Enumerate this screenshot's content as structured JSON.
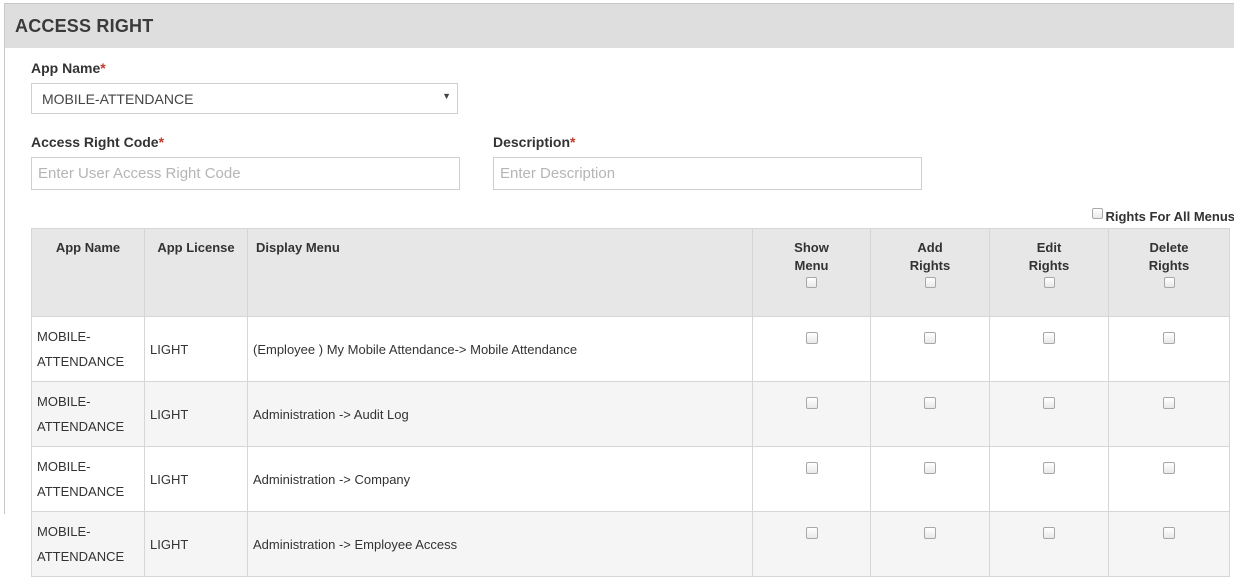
{
  "header": {
    "title": "ACCESS RIGHT"
  },
  "form": {
    "app_name": {
      "label": "App Name",
      "required_mark": "*",
      "value": "MOBILE-ATTENDANCE",
      "arrow": "▼"
    },
    "access_right_code": {
      "label": "Access Right Code",
      "required_mark": "*",
      "placeholder": "Enter User Access Right Code"
    },
    "description": {
      "label": "Description",
      "required_mark": "*",
      "placeholder": "Enter Description"
    }
  },
  "rights_for_all_menus": {
    "label": "Rights For All Menus",
    "checked": false
  },
  "table": {
    "columns": {
      "app_name": "App Name",
      "app_license": "App License",
      "display_menu": "Display Menu",
      "show_menu": [
        "Show",
        "Menu"
      ],
      "add_rights": [
        "Add",
        "Rights"
      ],
      "edit_rights": [
        "Edit",
        "Rights"
      ],
      "delete_rights": [
        "Delete",
        "Rights"
      ]
    },
    "rows": [
      {
        "app_name": "MOBILE-ATTENDANCE",
        "app_license": "LIGHT",
        "display_menu": "(Employee ) My Mobile Attendance-> Mobile Attendance"
      },
      {
        "app_name": "MOBILE-ATTENDANCE",
        "app_license": "LIGHT",
        "display_menu": "Administration -> Audit Log"
      },
      {
        "app_name": "MOBILE-ATTENDANCE",
        "app_license": "LIGHT",
        "display_menu": "Administration -> Company"
      },
      {
        "app_name": "MOBILE-ATTENDANCE",
        "app_license": "LIGHT",
        "display_menu": "Administration -> Employee Access"
      }
    ]
  },
  "colors": {
    "header_bg": "#dedede",
    "required": "#c0392b",
    "table_header_bg": "#e7e7e7",
    "row_alt_bg": "#f5f5f5"
  }
}
